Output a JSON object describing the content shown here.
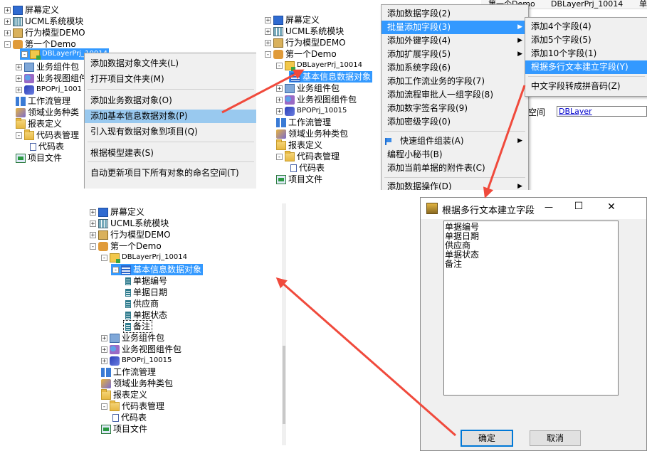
{
  "panel1": {
    "tree": [
      {
        "label": "屏幕定义",
        "expander": "+",
        "icon": "screen-icon"
      },
      {
        "label": "UCML系统模块",
        "expander": "+",
        "icon": "grid-icon"
      },
      {
        "label": "行为模型DEMO",
        "expander": "+",
        "icon": "module-icon"
      },
      {
        "label": "第一个Demo",
        "expander": "-",
        "icon": "hand-icon"
      },
      {
        "label": "DBLayerPrj_10014",
        "expander": "-",
        "icon": "project-icon"
      },
      {
        "label": "业务组件包",
        "expander": "+",
        "icon": "package-icon"
      },
      {
        "label": "业务视图组件",
        "expander": "+",
        "icon": "view-icon"
      },
      {
        "label": "BPOPrj_1001",
        "expander": "+",
        "icon": "bpo-icon"
      },
      {
        "label": "工作流管理",
        "expander": "",
        "icon": "workflow-icon"
      },
      {
        "label": "领域业务种类",
        "expander": "",
        "icon": "domain-icon"
      },
      {
        "label": "报表定义",
        "expander": "",
        "icon": "folder-icon"
      },
      {
        "label": "代码表管理",
        "expander": "-",
        "icon": "folder-icon"
      },
      {
        "label": "代码表",
        "expander": "",
        "icon": "code-icon"
      },
      {
        "label": "项目文件",
        "expander": "",
        "icon": "file-icon"
      }
    ],
    "context_menu": [
      "添加数据对象文件夹(L)",
      "打开项目文件夹(M)",
      "添加业务数据对象(O)",
      "添加基本信息数据对象(P)",
      "引入现有数据对象到项目(Q)",
      "根据模型建表(S)",
      "自动更新项目下所有对象的命名空间(T)"
    ]
  },
  "panel2": {
    "tree": [
      {
        "label": "屏幕定义",
        "expander": "+",
        "icon": "screen-icon"
      },
      {
        "label": "UCML系统模块",
        "expander": "+",
        "icon": "grid-icon"
      },
      {
        "label": "行为模型DEMO",
        "expander": "+",
        "icon": "module-icon"
      },
      {
        "label": "第一个Demo",
        "expander": "-",
        "icon": "hand-icon"
      },
      {
        "label": "DBLayerPrj_10014",
        "expander": "-",
        "icon": "project-icon"
      },
      {
        "label": "基本信息数据对象",
        "expander": "",
        "icon": "table-icon"
      },
      {
        "label": "业务组件包",
        "expander": "+",
        "icon": "package-icon"
      },
      {
        "label": "业务视图组件包",
        "expander": "+",
        "icon": "view-icon"
      },
      {
        "label": "BPOPrj_10015",
        "expander": "+",
        "icon": "bpo-icon"
      },
      {
        "label": "工作流管理",
        "expander": "",
        "icon": "workflow-icon"
      },
      {
        "label": "领域业务种类包",
        "expander": "",
        "icon": "domain-icon"
      },
      {
        "label": "报表定义",
        "expander": "",
        "icon": "folder-icon"
      },
      {
        "label": "代码表管理",
        "expander": "-",
        "icon": "folder-icon"
      },
      {
        "label": "代码表",
        "expander": "",
        "icon": "code-icon"
      },
      {
        "label": "项目文件",
        "expander": "",
        "icon": "file-icon"
      }
    ],
    "context_menu": [
      "添加数据字段(2)",
      "批量添加字段(3)",
      "添加外键字段(4)",
      "添加扩展字段(5)",
      "添加系统字段(6)",
      "添加工作流业务的字段(7)",
      "添加流程审批人一组字段(8)",
      "添加数字签名字段(9)",
      "添加密级字段(0)",
      "快速组件组装(A)",
      "编程小秘书(B)",
      "添加当前单据的附件表(C)",
      "添加数据操作(D)"
    ],
    "submenu": [
      "添加4个字段(4)",
      "添加5个字段(5)",
      "添加10个字段(1)",
      "根据多行文本建立字段(Y)",
      "中文字段转成拼音码(Z)"
    ],
    "bg_header": {
      "crumb1": "第一个Demo",
      "crumb2": "DBLayerPrj_10014",
      "crumb3": "单"
    },
    "bg_label": "空间",
    "bg_value": "DBLayer"
  },
  "panel3": {
    "tree": [
      {
        "label": "屏幕定义",
        "expander": "+",
        "icon": "screen-icon"
      },
      {
        "label": "UCML系统模块",
        "expander": "+",
        "icon": "grid-icon"
      },
      {
        "label": "行为模型DEMO",
        "expander": "+",
        "icon": "module-icon"
      },
      {
        "label": "第一个Demo",
        "expander": "-",
        "icon": "hand-icon"
      },
      {
        "label": "DBLayerPrj_10014",
        "expander": "-",
        "icon": "project-icon"
      },
      {
        "label": "基本信息数据对象",
        "expander": "-",
        "icon": "table-icon"
      },
      {
        "label": "单据编号",
        "expander": "",
        "icon": "field-icon"
      },
      {
        "label": "单据日期",
        "expander": "",
        "icon": "field-icon"
      },
      {
        "label": "供应商",
        "expander": "",
        "icon": "field-icon"
      },
      {
        "label": "单据状态",
        "expander": "",
        "icon": "field-icon"
      },
      {
        "label": "备注",
        "expander": "",
        "icon": "field-icon"
      },
      {
        "label": "业务组件包",
        "expander": "+",
        "icon": "package-icon"
      },
      {
        "label": "业务视图组件包",
        "expander": "+",
        "icon": "view-icon"
      },
      {
        "label": "BPOPrj_10015",
        "expander": "+",
        "icon": "bpo-icon"
      },
      {
        "label": "工作流管理",
        "expander": "",
        "icon": "workflow-icon"
      },
      {
        "label": "领域业务种类包",
        "expander": "",
        "icon": "domain-icon"
      },
      {
        "label": "报表定义",
        "expander": "",
        "icon": "folder-icon"
      },
      {
        "label": "代码表管理",
        "expander": "-",
        "icon": "folder-icon"
      },
      {
        "label": "代码表",
        "expander": "",
        "icon": "code-icon"
      },
      {
        "label": "项目文件",
        "expander": "",
        "icon": "file-icon"
      }
    ]
  },
  "dialog": {
    "title": "根据多行文本建立字段",
    "lines": [
      "单据编号",
      "单据日期",
      "供应商",
      "单据状态",
      "备注"
    ],
    "ok_label": "确定",
    "cancel_label": "取消",
    "minimize": "—",
    "maximize": "☐",
    "close": "✕"
  },
  "colors": {
    "selection": "#3399ff",
    "menu_hover": "#99c9ef",
    "arrow": "#f04a3c"
  }
}
